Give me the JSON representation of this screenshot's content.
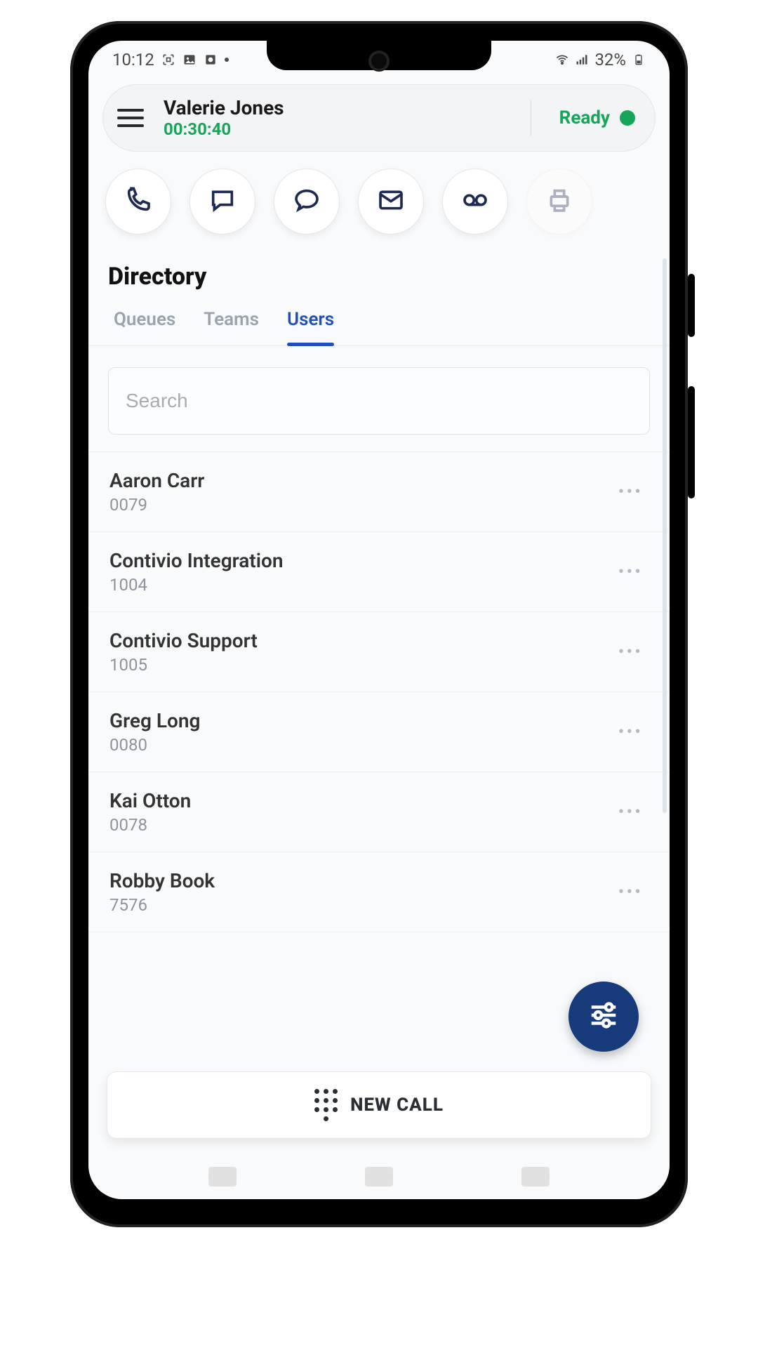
{
  "status_bar": {
    "time": "10:12",
    "battery_text": "32%"
  },
  "header": {
    "user_name": "Valerie Jones",
    "timer": "00:30:40",
    "status_label": "Ready",
    "status_color": "#17a559"
  },
  "channels": [
    {
      "id": "phone",
      "icon": "phone-icon",
      "enabled": true
    },
    {
      "id": "sms",
      "icon": "sms-icon",
      "enabled": true
    },
    {
      "id": "chat",
      "icon": "chat-icon",
      "enabled": true
    },
    {
      "id": "email",
      "icon": "email-icon",
      "enabled": true
    },
    {
      "id": "voicemail",
      "icon": "voicemail-icon",
      "enabled": true
    },
    {
      "id": "fax",
      "icon": "fax-icon",
      "enabled": false
    }
  ],
  "section": {
    "title": "Directory"
  },
  "tabs": {
    "items": [
      {
        "id": "queues",
        "label": "Queues"
      },
      {
        "id": "teams",
        "label": "Teams"
      },
      {
        "id": "users",
        "label": "Users"
      }
    ],
    "active": "users"
  },
  "search": {
    "placeholder": "Search",
    "value": ""
  },
  "users": [
    {
      "name": "Aaron Carr",
      "extension": "0079"
    },
    {
      "name": "Contivio Integration",
      "extension": "1004"
    },
    {
      "name": "Contivio Support",
      "extension": "1005"
    },
    {
      "name": "Greg Long",
      "extension": "0080"
    },
    {
      "name": "Kai Otton",
      "extension": "0078"
    },
    {
      "name": "Robby Book",
      "extension": "7576"
    }
  ],
  "new_call": {
    "label": "NEW CALL"
  },
  "colors": {
    "accent": "#1f4fbf",
    "fab": "#163a7a",
    "success": "#17a559"
  }
}
